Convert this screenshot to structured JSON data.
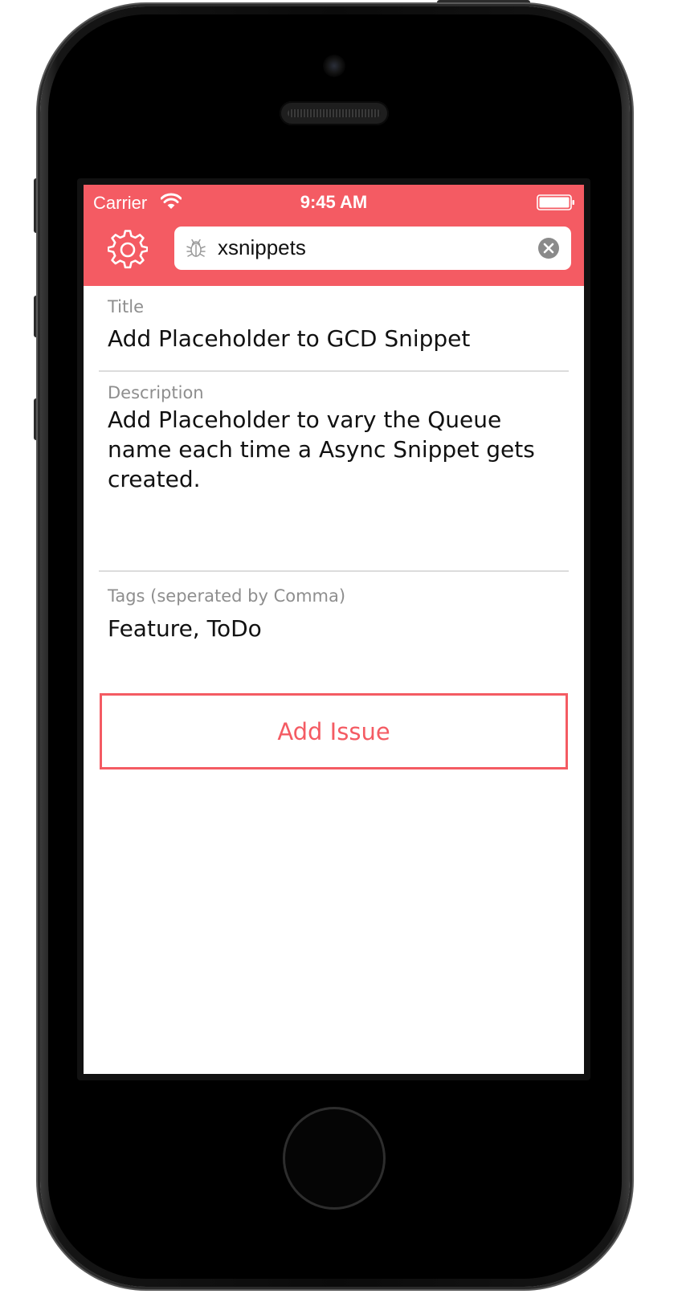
{
  "status_bar": {
    "carrier": "Carrier",
    "time": "9:45 AM",
    "icons": [
      "wifi-icon",
      "battery-icon"
    ]
  },
  "nav_bar": {
    "settings_icon": "gear-icon",
    "search": {
      "icon": "bug-icon",
      "value": "xsnippets",
      "clear_icon": "clear-icon"
    }
  },
  "form": {
    "title": {
      "label": "Title",
      "value": "Add Placeholder to GCD Snippet"
    },
    "description": {
      "label": "Description",
      "value": "Add Placeholder to vary the Queue name each time a Async Snippet gets created."
    },
    "tags": {
      "label": "Tags (seperated by Comma)",
      "value": "Feature, ToDo"
    },
    "submit_label": "Add Issue"
  },
  "colors": {
    "accent": "#f45b63",
    "label": "#8e8e8e",
    "text": "#111111",
    "separator": "#dcdcdc"
  }
}
